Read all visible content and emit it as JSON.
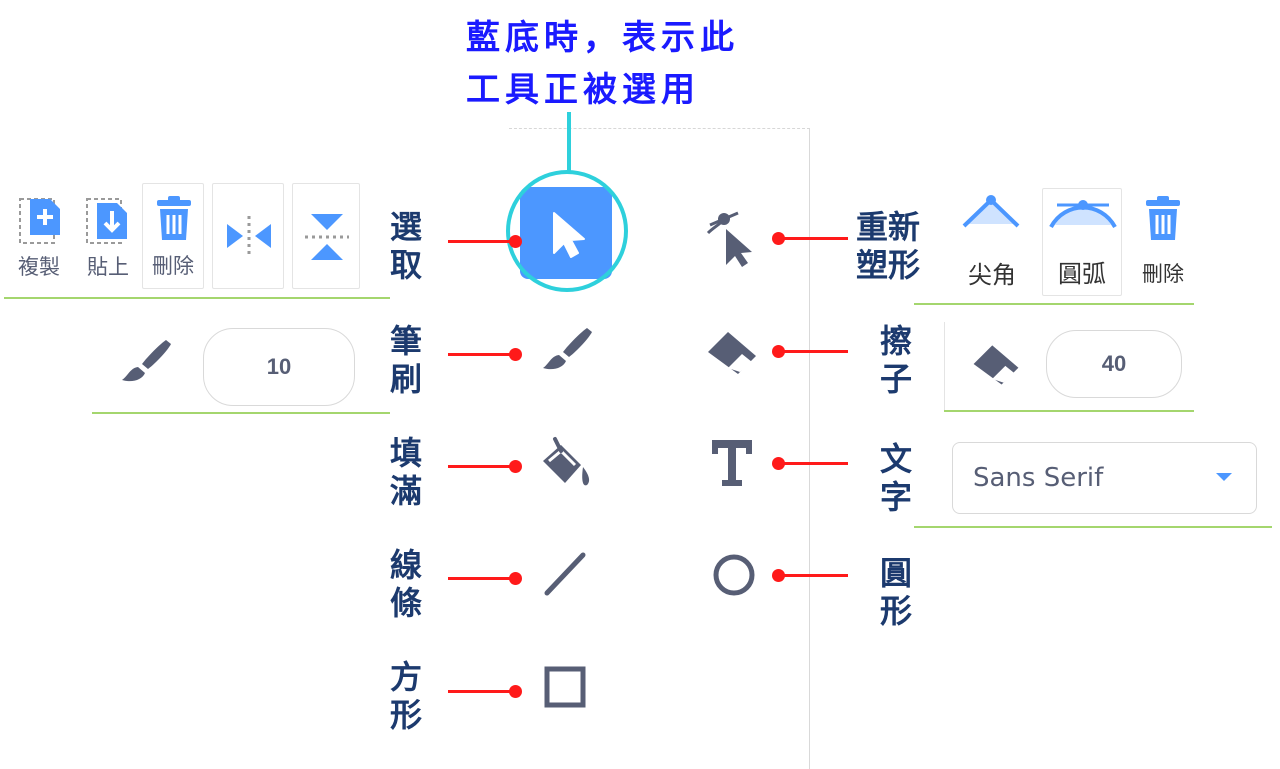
{
  "annotation": {
    "line1": "藍底時，表示此",
    "line2": "工具正被選用"
  },
  "tools_left": [
    {
      "label": "選取",
      "icon": "select-arrow-icon"
    },
    {
      "label": "筆刷",
      "icon": "brush-icon"
    },
    {
      "label": "填滿",
      "icon": "fill-bucket-icon"
    },
    {
      "label": "線條",
      "icon": "line-icon"
    },
    {
      "label": "方形",
      "icon": "rectangle-icon"
    }
  ],
  "tools_right": [
    {
      "label": "重新塑形",
      "icon": "reshape-icon"
    },
    {
      "label": "擦子",
      "icon": "eraser-icon"
    },
    {
      "label": "文字",
      "icon": "text-icon"
    },
    {
      "label": "圓形",
      "icon": "circle-icon"
    }
  ],
  "select_toolbar": {
    "copy": "複製",
    "paste": "貼上",
    "delete": "刪除",
    "flip_horizontal_icon": "flip-horizontal-icon",
    "flip_vertical_icon": "flip-vertical-icon"
  },
  "reshape_toolbar": {
    "pointed": "尖角",
    "curved": "圓弧",
    "delete": "刪除"
  },
  "brush_size": "10",
  "eraser_size": "40",
  "font_select": {
    "value": "Sans Serif"
  },
  "colors": {
    "accent": "#4c97ff",
    "icon": "#575e75",
    "callout": "#2ed0dc",
    "pointer": "#ff1a1a",
    "label": "#1c3a6e",
    "title": "#1a1aff"
  }
}
